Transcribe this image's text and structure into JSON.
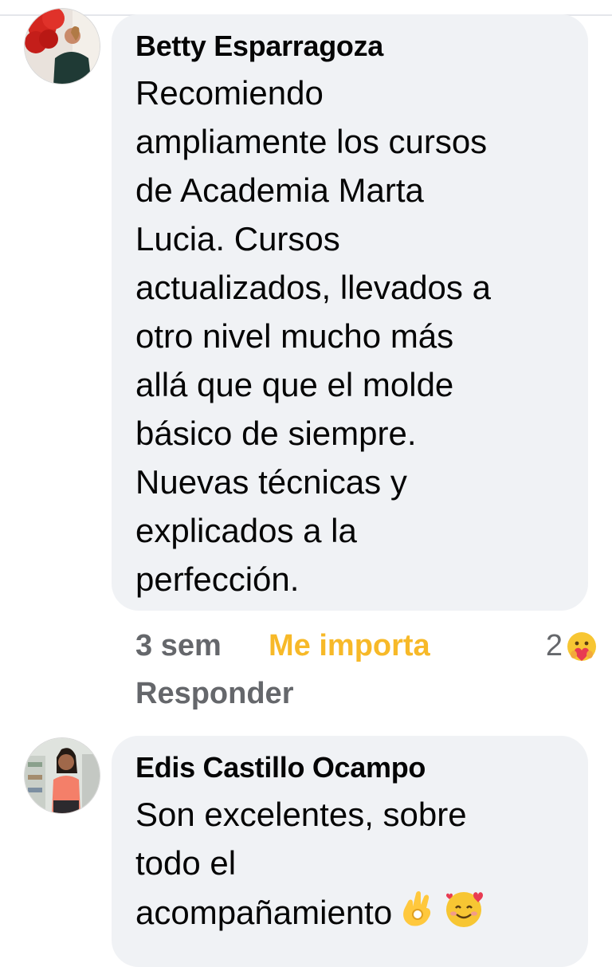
{
  "comments": [
    {
      "author": "Betty Esparragoza",
      "text": "Recomiendo\nampliamente los cursos\nde Academia Marta\nLucia.  Cursos\nactualizados, llevados a\notro nivel mucho más\nallá que que el molde\nbásico de siempre.\nNuevas técnicas y\nexplicados a la\nperfección.",
      "time": "3 sem",
      "react_label": "Me importa",
      "reaction_count": "2",
      "reply_label": "Responder"
    },
    {
      "author": "Edis Castillo Ocampo",
      "text": "Son excelentes, sobre\ntodo el\nacompañamiento"
    }
  ],
  "colors": {
    "bubble": "#f0f2f5",
    "care_reaction": "#f7b928",
    "muted_text": "#65676b"
  },
  "icons": [
    "care-reaction-icon",
    "ok-hand-emoji",
    "smiling-face-with-hearts-emoji"
  ]
}
